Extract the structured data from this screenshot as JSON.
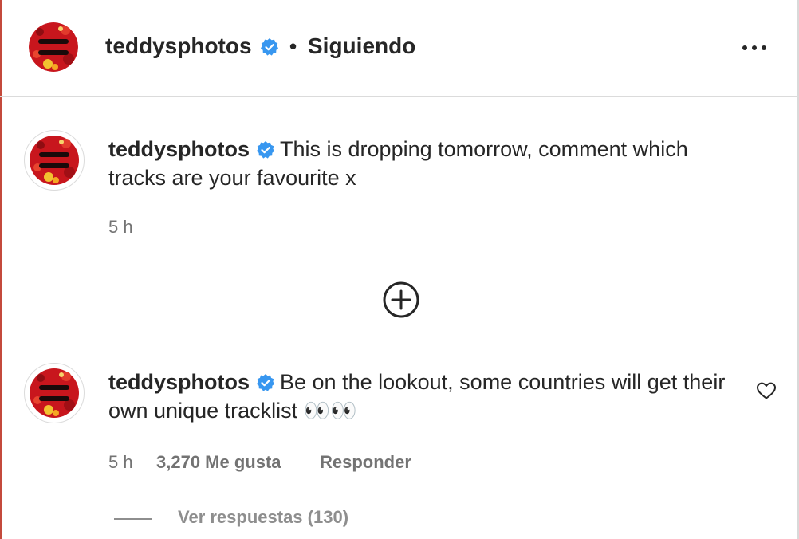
{
  "header": {
    "username": "teddysphotos",
    "separator": "•",
    "follow_status": "Siguiendo",
    "verified_icon": "verified-badge-icon",
    "more_icon": "more-horizontal-icon"
  },
  "caption": {
    "username": "teddysphotos",
    "text": "This is dropping tomorrow, comment which tracks are your favourite x",
    "time": "5 h"
  },
  "load_more": {
    "icon": "plus-circle-icon"
  },
  "comment": {
    "username": "teddysphotos",
    "text": "Be on the lookout, some countries will get their own unique tracklist 👀👀",
    "time": "5 h",
    "likes": "3,270 Me gusta",
    "reply_label": "Responder",
    "like_icon": "heart-icon",
    "view_replies": "Ver respuestas (130)"
  },
  "colors": {
    "verified": "#3897f0",
    "text": "#262626",
    "secondary": "#737373",
    "avatar_red": "#c8161d"
  }
}
